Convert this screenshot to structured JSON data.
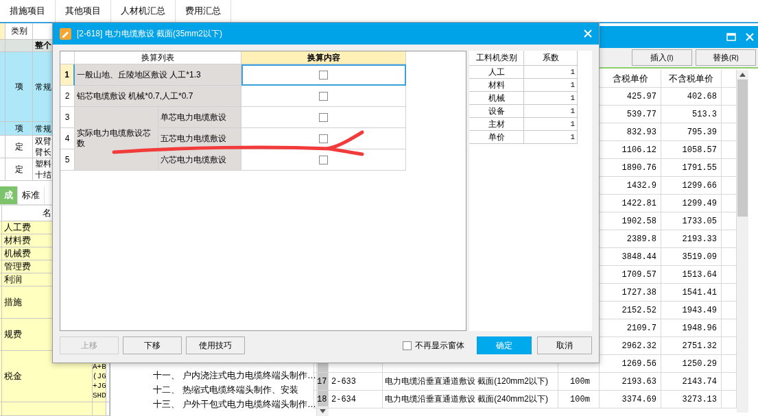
{
  "top_tabs": [
    {
      "label": "措施项目"
    },
    {
      "label": "其他项目"
    },
    {
      "label": "人材机汇总"
    },
    {
      "label": "费用汇总"
    }
  ],
  "left_table": {
    "header": "类别",
    "group_label": "整个",
    "rows": [
      {
        "type": "项",
        "name_lines": [
          "常规"
        ],
        "selected": true,
        "kind": "tall"
      },
      {
        "type": "项",
        "name_lines": [
          "常规"
        ],
        "selected": true,
        "kind": "short"
      },
      {
        "type": "定",
        "name_lines": [
          "双臂",
          "臂长"
        ],
        "selected": false,
        "kind": "mid"
      },
      {
        "type": "定",
        "name_lines": [
          "塑料",
          "十结"
        ],
        "selected": false,
        "kind": "mid"
      }
    ]
  },
  "sub_tabs": [
    {
      "label": "成",
      "selected": true
    },
    {
      "label": "标准",
      "selected": false
    }
  ],
  "fee_table": {
    "header": "名",
    "rows": [
      {
        "name": "人工费",
        "kind": "single"
      },
      {
        "name": "材料费",
        "kind": "single"
      },
      {
        "name": "机械费",
        "kind": "single"
      },
      {
        "name": "管理费",
        "kind": "single"
      },
      {
        "name": "利润",
        "kind": "single"
      },
      {
        "name": "措施",
        "kind": "double"
      },
      {
        "name": "规费",
        "kind": "double"
      },
      {
        "name": "税金",
        "kind": "triple",
        "formula_lines": [
          "A+B",
          "(JG",
          "+JG",
          "SHD"
        ]
      }
    ]
  },
  "tree_items": [
    {
      "number": "十一、",
      "text": "户内浇注式电力电缆终端头制作…"
    },
    {
      "number": "十二、",
      "text": "热缩式电缆终端头制作、安装"
    },
    {
      "number": "十三、",
      "text": "户外干包式电力电缆终端头制作…"
    }
  ],
  "item_window": {
    "buttons": [
      {
        "label": "插入",
        "key": "(I)"
      },
      {
        "label": "替换",
        "key": "(R)"
      }
    ],
    "columns": [
      "含税单价",
      "不含税单价"
    ],
    "rows": [
      {
        "prices": [
          "425.97",
          "402.68"
        ]
      },
      {
        "prices": [
          "539.77",
          "513.3"
        ]
      },
      {
        "prices": [
          "832.93",
          "795.39"
        ]
      },
      {
        "prices": [
          "1106.12",
          "1058.57"
        ]
      },
      {
        "prices": [
          "1890.76",
          "1791.55"
        ]
      },
      {
        "prices": [
          "1432.9",
          "1299.66"
        ]
      },
      {
        "prices": [
          "1422.81",
          "1299.49"
        ]
      },
      {
        "prices": [
          "1902.58",
          "1733.05"
        ]
      },
      {
        "prices": [
          "2389.8",
          "2193.33"
        ]
      },
      {
        "prices": [
          "3848.44",
          "3519.09"
        ]
      },
      {
        "prices": [
          "1709.57",
          "1513.64"
        ]
      },
      {
        "prices": [
          "1727.38",
          "1541.41"
        ]
      },
      {
        "prices": [
          "2152.52",
          "1943.49"
        ]
      },
      {
        "prices": [
          "2109.7",
          "1948.96"
        ]
      },
      {
        "prices": [
          "2962.32",
          "2751.32"
        ]
      },
      {
        "prices": [
          "1269.56",
          "1250.29"
        ]
      },
      {
        "no": "17",
        "code": "2-633",
        "name": "电力电缆沿垂直通道敷设 截面(120mm2以下)",
        "unit": "100m",
        "prices": [
          "2193.63",
          "2143.74"
        ]
      },
      {
        "no": "18",
        "code": "2-634",
        "name": "电力电缆沿垂直通道敷设 截面(240mm2以下)",
        "unit": "100m",
        "prices": [
          "3374.69",
          "3273.13"
        ]
      }
    ]
  },
  "dialog": {
    "title": "[2-618] 电力电缆敷设 截面(35mm2以下)",
    "columns": [
      "换算列表",
      "换算内容"
    ],
    "rows": [
      {
        "kind": "single",
        "no": "1",
        "label": "一般山地、丘陵地区敷设 人工*1.3",
        "checked": false,
        "selected": true
      },
      {
        "kind": "single",
        "no": "2",
        "label": "铝芯电缆敷设 机械*0.7,人工*0.7",
        "checked": false,
        "selected": false
      },
      {
        "kind": "group",
        "label": "实际电力电缆敷设芯数",
        "options": [
          {
            "no": "3",
            "label": "单芯电力电缆敷设",
            "checked": false,
            "selected": false
          },
          {
            "no": "4",
            "label": "五芯电力电缆敷设",
            "checked": false,
            "selected": false
          },
          {
            "no": "5",
            "label": "六芯电力电缆敷设",
            "checked": false,
            "selected": false
          }
        ]
      }
    ],
    "factor_table": {
      "columns": [
        "工料机类别",
        "系数"
      ],
      "rows": [
        {
          "category": "人工",
          "factor": "1"
        },
        {
          "category": "材料",
          "factor": "1"
        },
        {
          "category": "机械",
          "factor": "1"
        },
        {
          "category": "设备",
          "factor": "1"
        },
        {
          "category": "主材",
          "factor": "1"
        },
        {
          "category": "单价",
          "factor": "1"
        }
      ]
    },
    "buttons": [
      {
        "label": "上移",
        "disabled": true
      },
      {
        "label": "下移",
        "disabled": false
      },
      {
        "label": "使用技巧",
        "disabled": false
      }
    ],
    "dont_show": {
      "label": "不再显示窗体",
      "checked": false
    },
    "ok": "确定",
    "cancel": "取消"
  }
}
